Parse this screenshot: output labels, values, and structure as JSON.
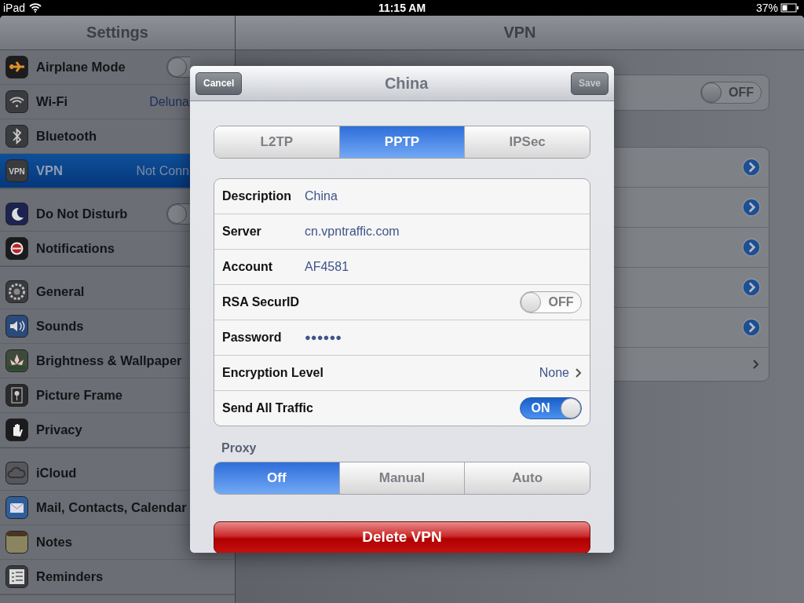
{
  "status_bar": {
    "device": "iPad",
    "time": "11:15 AM",
    "battery": "37%"
  },
  "sidebar": {
    "title": "Settings",
    "groups": [
      {
        "items": [
          {
            "label": "Airplane Mode",
            "kind": "toggle",
            "on": false,
            "selected": false
          },
          {
            "label": "Wi-Fi",
            "kind": "value",
            "value": "Deluna",
            "selected": false
          },
          {
            "label": "Bluetooth",
            "kind": "plain",
            "selected": false
          },
          {
            "label": "VPN",
            "kind": "value",
            "value": "Not Conn",
            "icon_label": "VPN",
            "selected": true
          }
        ]
      },
      {
        "items": [
          {
            "label": "Do Not Disturb",
            "kind": "toggle",
            "on": false,
            "selected": false
          },
          {
            "label": "Notifications",
            "kind": "plain",
            "selected": false
          }
        ]
      },
      {
        "items": [
          {
            "label": "General",
            "kind": "plain",
            "selected": false
          },
          {
            "label": "Sounds",
            "kind": "plain",
            "selected": false
          },
          {
            "label": "Brightness & Wallpaper",
            "kind": "plain",
            "selected": false
          },
          {
            "label": "Picture Frame",
            "kind": "plain",
            "selected": false
          },
          {
            "label": "Privacy",
            "kind": "plain",
            "selected": false
          }
        ]
      },
      {
        "items": [
          {
            "label": "iCloud",
            "kind": "plain",
            "selected": false
          },
          {
            "label": "Mail, Contacts, Calendar",
            "kind": "plain",
            "selected": false
          },
          {
            "label": "Notes",
            "kind": "plain",
            "selected": false
          },
          {
            "label": "Reminders",
            "kind": "plain",
            "selected": false
          }
        ]
      }
    ]
  },
  "detail": {
    "title": "VPN",
    "vpn_switch": {
      "on": false,
      "label": "OFF"
    },
    "configurations": [
      {
        "kind": "detail"
      },
      {
        "kind": "detail"
      },
      {
        "kind": "detail"
      },
      {
        "kind": "detail"
      },
      {
        "kind": "detail"
      },
      {
        "kind": "more"
      }
    ]
  },
  "dialog": {
    "title": "China",
    "cancel": "Cancel",
    "save": {
      "label": "Save",
      "disabled": true
    },
    "type_tabs": [
      {
        "label": "L2TP",
        "selected": false
      },
      {
        "label": "PPTP",
        "selected": true
      },
      {
        "label": "IPSec",
        "selected": false
      }
    ],
    "fields": [
      {
        "label": "Description",
        "kind": "text",
        "value": "China"
      },
      {
        "label": "Server",
        "kind": "text",
        "value": "cn.vpntraffic.com"
      },
      {
        "label": "Account",
        "kind": "text",
        "value": "AF4581"
      },
      {
        "label": "RSA SecurID",
        "kind": "toggle",
        "on": false,
        "value": "OFF"
      },
      {
        "label": "Password",
        "kind": "password",
        "value": "●●●●●●"
      },
      {
        "label": "Encryption Level",
        "kind": "choice",
        "value": "None"
      },
      {
        "label": "Send All Traffic",
        "kind": "toggle",
        "on": true,
        "value": "ON"
      }
    ],
    "proxy_label": "Proxy",
    "proxy_tabs": [
      {
        "label": "Off",
        "selected": true
      },
      {
        "label": "Manual",
        "selected": false
      },
      {
        "label": "Auto",
        "selected": false
      }
    ],
    "delete": "Delete VPN"
  }
}
